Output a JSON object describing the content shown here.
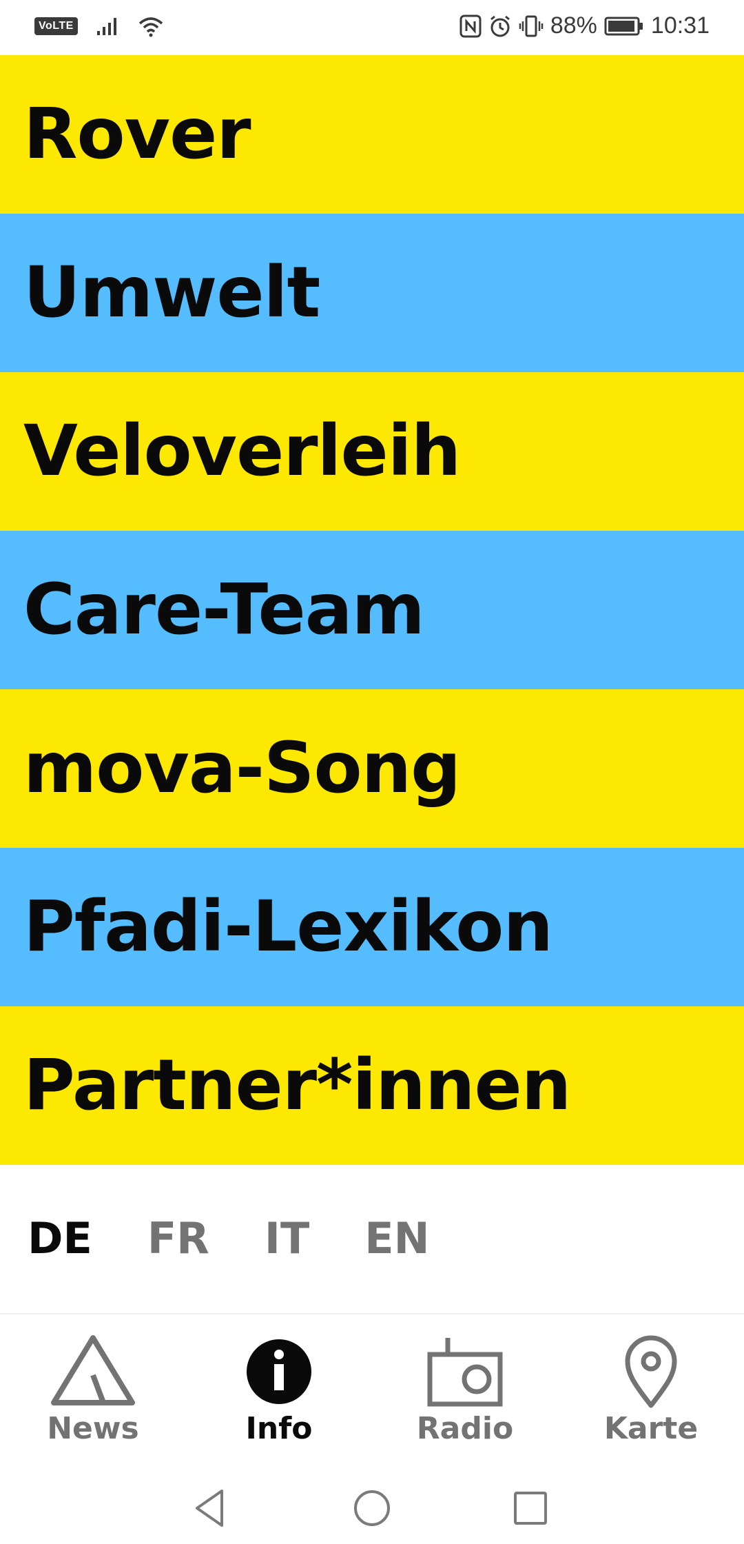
{
  "status_bar": {
    "volte": "VoLTE",
    "battery": "88%",
    "time": "10:31"
  },
  "menu": {
    "items": [
      {
        "label": "Rover",
        "color": "#fce800"
      },
      {
        "label": "Umwelt",
        "color": "#55bdfd"
      },
      {
        "label": "Veloverleih",
        "color": "#fce800"
      },
      {
        "label": "Care-Team",
        "color": "#55bdfd"
      },
      {
        "label": "mova-Song",
        "color": "#fce800"
      },
      {
        "label": "Pfadi-Lexikon",
        "color": "#55bdfd"
      },
      {
        "label": "Partner*innen",
        "color": "#fce800"
      }
    ]
  },
  "languages": {
    "items": [
      "DE",
      "FR",
      "IT",
      "EN"
    ],
    "active": "DE"
  },
  "bottom_nav": {
    "items": [
      {
        "label": "News",
        "icon": "tent-icon"
      },
      {
        "label": "Info",
        "icon": "info-icon"
      },
      {
        "label": "Radio",
        "icon": "radio-icon"
      },
      {
        "label": "Karte",
        "icon": "map-pin-icon"
      }
    ],
    "active": "Info"
  },
  "colors": {
    "yellow": "#fce800",
    "blue": "#55bdfd",
    "text": "#0a0a0a",
    "inactive": "#737373"
  }
}
